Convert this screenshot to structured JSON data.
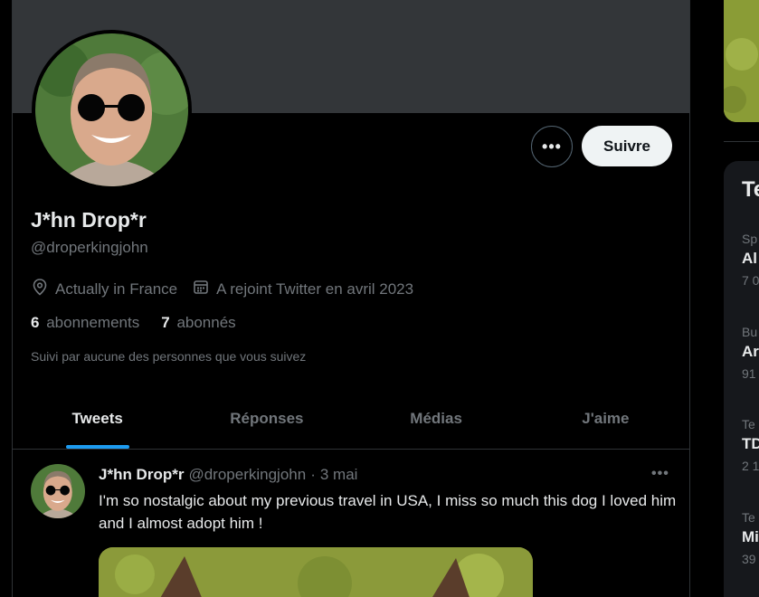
{
  "profile": {
    "display_name": "J*hn Drop*r",
    "handle": "@droperkingjohn",
    "location": "Actually in France",
    "joined": "A rejoint Twitter en avril 2023",
    "following_count": "6",
    "following_label": "abonnements",
    "followers_count": "7",
    "followers_label": "abonnés",
    "followed_by": "Suivi par aucune des personnes que vous suivez"
  },
  "actions": {
    "more_label": "•••",
    "follow_label": "Suivre"
  },
  "tabs": [
    {
      "label": "Tweets",
      "active": true
    },
    {
      "label": "Réponses",
      "active": false
    },
    {
      "label": "Médias",
      "active": false
    },
    {
      "label": "J'aime",
      "active": false
    }
  ],
  "tweet": {
    "name": "J*hn Drop*r",
    "handle": "@droperkingjohn",
    "dot": "·",
    "date": "3 mai",
    "more_label": "•••",
    "text": "I'm so nostalgic about my previous travel in USA, I miss so much this dog I loved him and I almost adopt him !"
  },
  "trends": {
    "title": "Te",
    "items": [
      {
        "category": "Sp",
        "name": "Al",
        "count": "7 0"
      },
      {
        "category": "Bu",
        "name": "Ar",
        "count": "91"
      },
      {
        "category": "Te",
        "name": "TD",
        "count": "2 1"
      },
      {
        "category": "Te",
        "name": "Mi",
        "count": "39"
      }
    ]
  },
  "colors": {
    "accent": "#1d9bf0",
    "background": "#000000",
    "banner": "#333639",
    "text_primary": "#e7e9ea",
    "text_secondary": "#71767b"
  },
  "icons": {
    "location": "map-pin-icon",
    "joined": "calendar-icon",
    "more": "ellipsis-icon"
  }
}
